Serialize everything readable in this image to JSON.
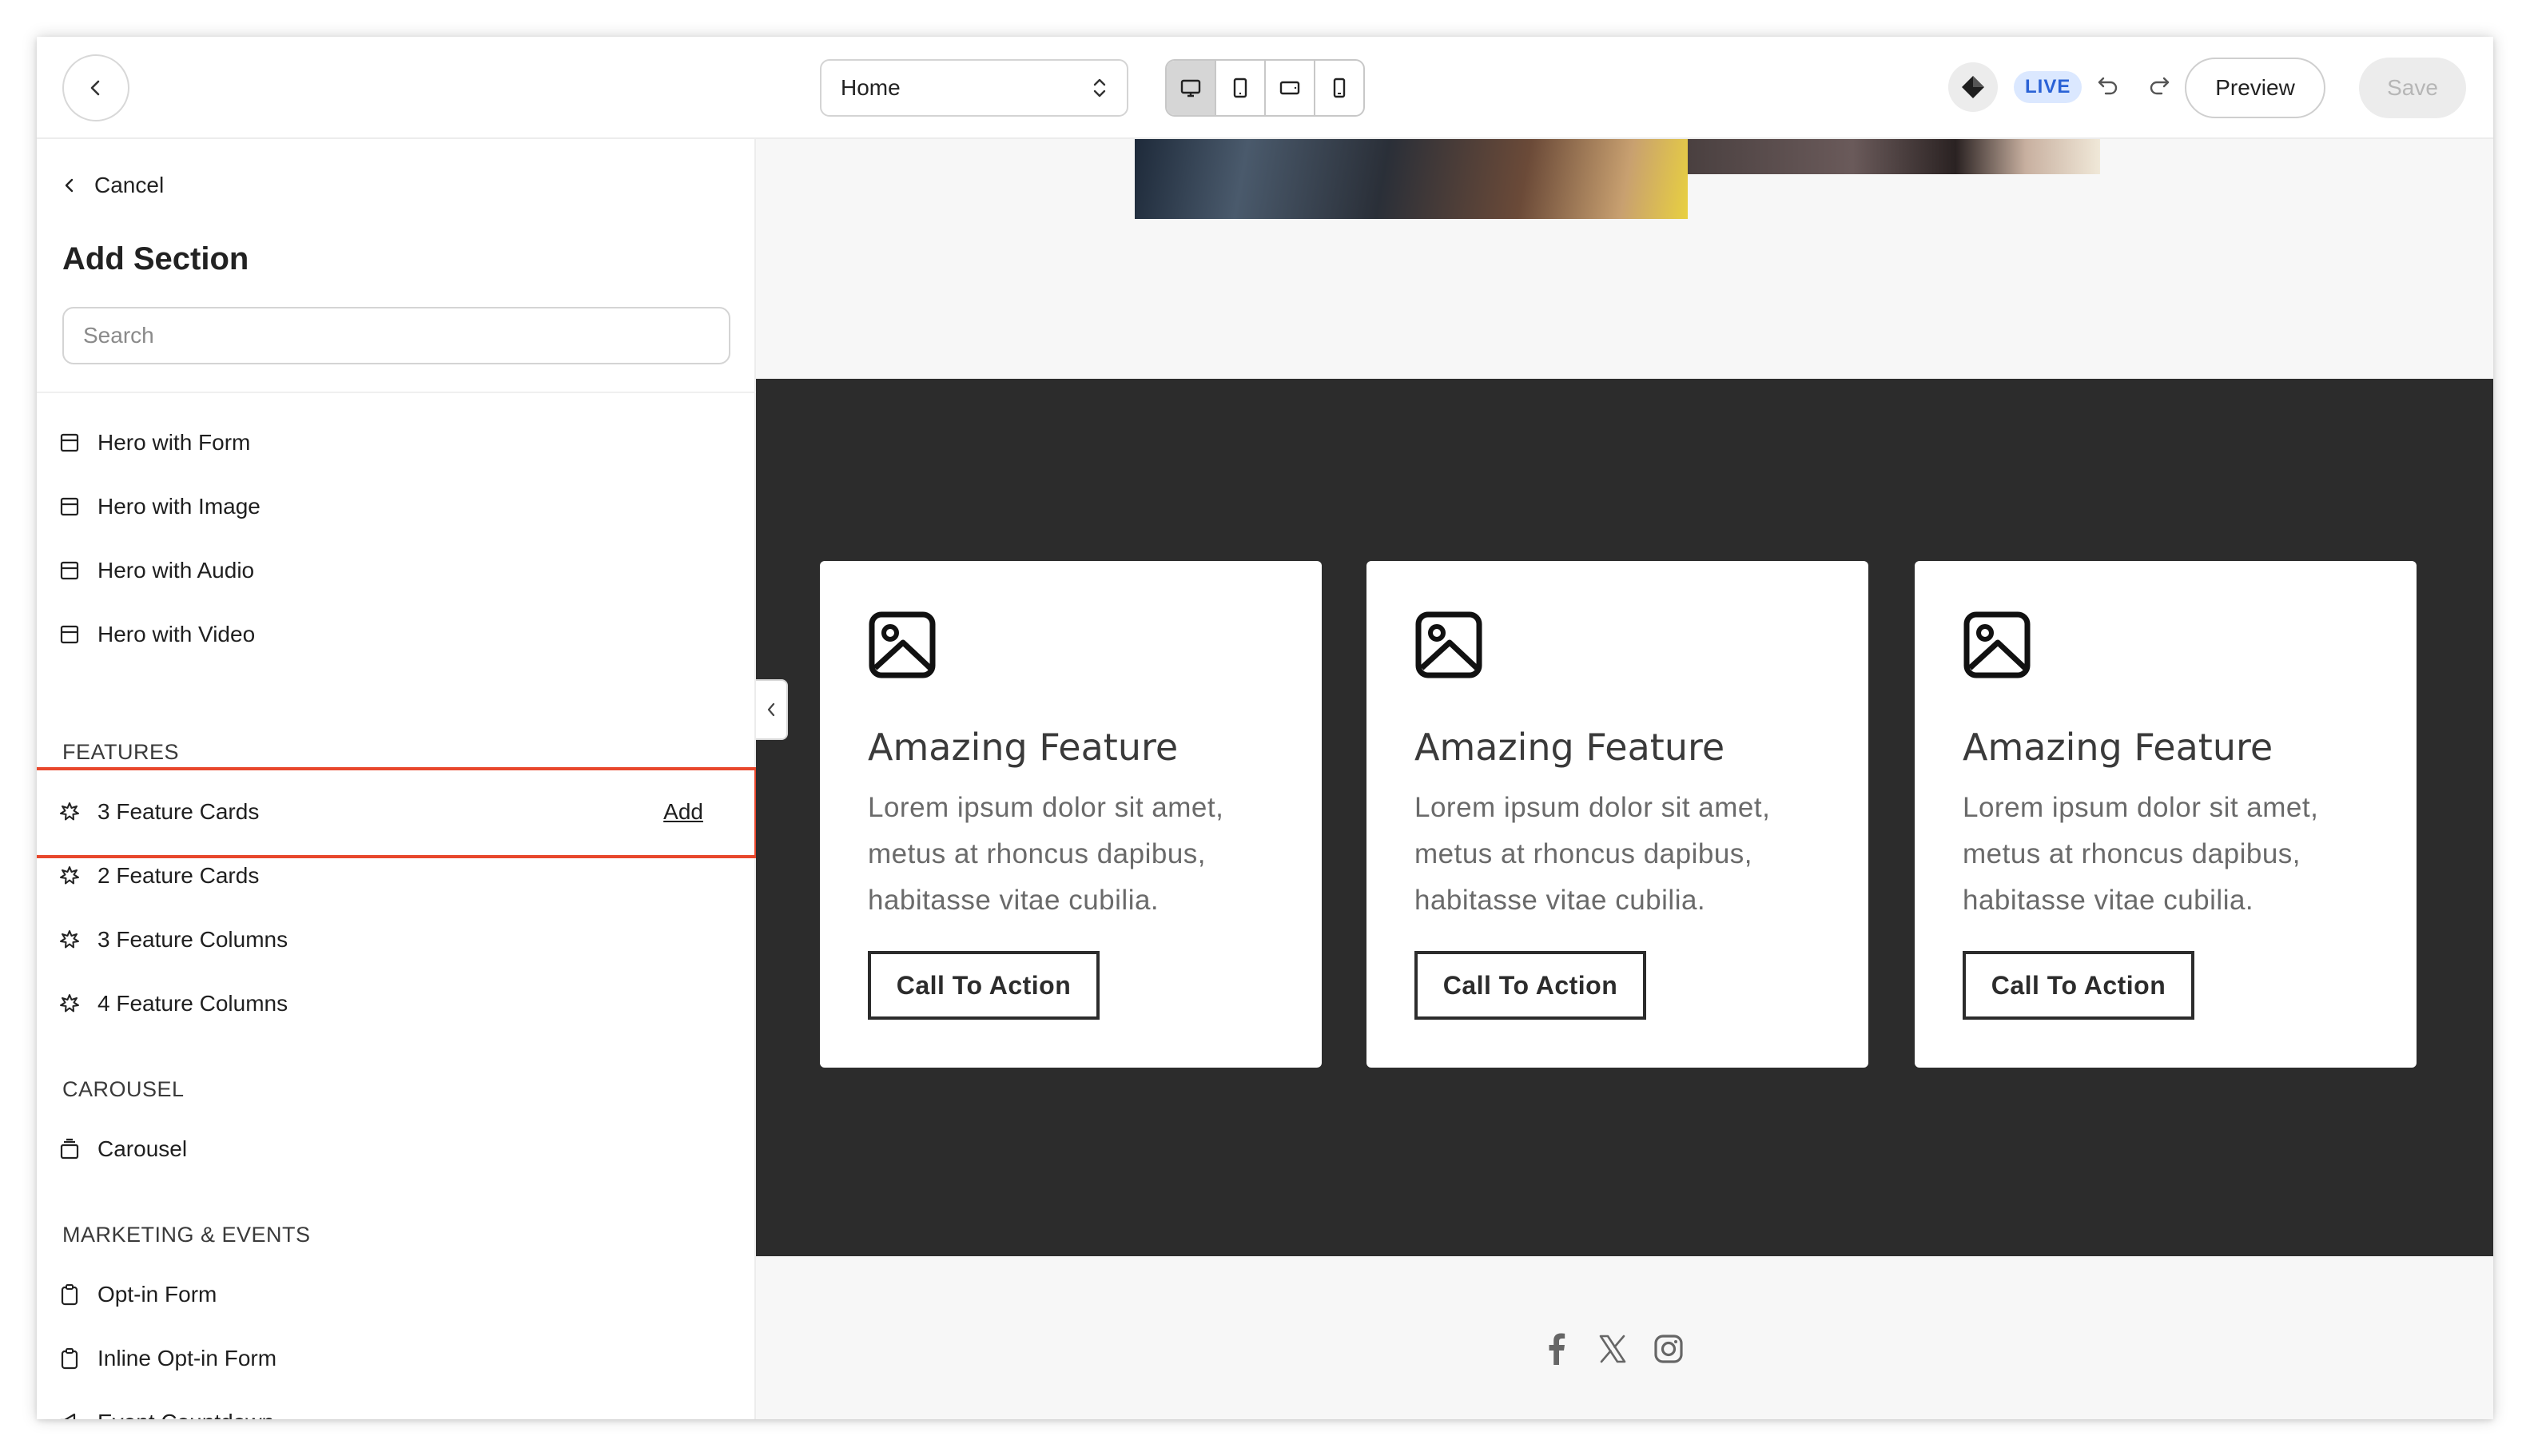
{
  "topbar": {
    "page_select": "Home",
    "live_badge": "LIVE",
    "preview_label": "Preview",
    "save_label": "Save",
    "device_icons": [
      "desktop-icon",
      "tablet-portrait-icon",
      "tablet-landscape-icon",
      "mobile-icon"
    ],
    "active_device": "desktop"
  },
  "sidebar": {
    "cancel_label": "Cancel",
    "title": "Add Section",
    "search_placeholder": "Search",
    "hero_items": [
      {
        "label": "Hero with Form",
        "icon": "section-icon"
      },
      {
        "label": "Hero with Image",
        "icon": "section-icon"
      },
      {
        "label": "Hero with Audio",
        "icon": "section-icon"
      },
      {
        "label": "Hero with Video",
        "icon": "section-icon"
      }
    ],
    "categories": {
      "features": "FEATURES",
      "carousel": "CAROUSEL",
      "marketing": "MARKETING & EVENTS"
    },
    "feature_items": [
      {
        "label": "3 Feature Cards",
        "icon": "sparkle-icon"
      },
      {
        "label": "2 Feature Cards",
        "icon": "sparkle-icon"
      },
      {
        "label": "3 Feature Columns",
        "icon": "sparkle-icon"
      },
      {
        "label": "4 Feature Columns",
        "icon": "sparkle-icon"
      }
    ],
    "add_label": "Add",
    "carousel_items": [
      {
        "label": "Carousel",
        "icon": "carousel-icon"
      }
    ],
    "marketing_items": [
      {
        "label": "Opt-in Form",
        "icon": "clipboard-icon"
      },
      {
        "label": "Inline Opt-in Form",
        "icon": "clipboard-icon"
      },
      {
        "label": "Event Countdown",
        "icon": "megaphone-icon"
      }
    ]
  },
  "canvas": {
    "cards": [
      {
        "title": "Amazing Feature",
        "body": "Lorem ipsum dolor sit amet, metus at rhoncus dapibus, habitasse vitae cubilia.",
        "cta": "Call To Action"
      },
      {
        "title": "Amazing Feature",
        "body": "Lorem ipsum dolor sit amet, metus at rhoncus dapibus, habitasse vitae cubilia.",
        "cta": "Call To Action"
      },
      {
        "title": "Amazing Feature",
        "body": "Lorem ipsum dolor sit amet, metus at rhoncus dapibus, habitasse vitae cubilia.",
        "cta": "Call To Action"
      }
    ],
    "social_icons": [
      "facebook-icon",
      "x-icon",
      "instagram-icon"
    ]
  },
  "colors": {
    "highlight": "#e8472c",
    "dark_band": "#2c2c2c",
    "live_bg": "#dbe8ff",
    "live_text": "#2a62d6"
  }
}
